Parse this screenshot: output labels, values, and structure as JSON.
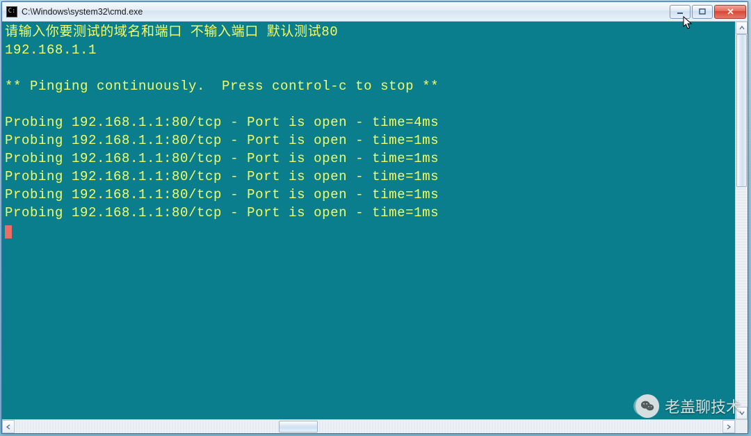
{
  "window": {
    "title": "C:\\Windows\\system32\\cmd.exe"
  },
  "colors": {
    "terminal_bg": "#0a7e8c",
    "terminal_fg": "#f7ff62",
    "cursor": "#eb6d66"
  },
  "terminal": {
    "prompt_line": "请输入你要测试的域名和端口 不输入端口 默认测试80",
    "input_value": "192.168.1.1",
    "status_line": "** Pinging continuously.  Press control-c to stop **",
    "probes": [
      {
        "target": "192.168.1.1:80/tcp",
        "status": "Port is open",
        "time": "4ms"
      },
      {
        "target": "192.168.1.1:80/tcp",
        "status": "Port is open",
        "time": "1ms"
      },
      {
        "target": "192.168.1.1:80/tcp",
        "status": "Port is open",
        "time": "1ms"
      },
      {
        "target": "192.168.1.1:80/tcp",
        "status": "Port is open",
        "time": "1ms"
      },
      {
        "target": "192.168.1.1:80/tcp",
        "status": "Port is open",
        "time": "1ms"
      },
      {
        "target": "192.168.1.1:80/tcp",
        "status": "Port is open",
        "time": "1ms"
      }
    ]
  },
  "watermark": {
    "text": "老盖聊技术",
    "icon": "wechat-icon"
  }
}
